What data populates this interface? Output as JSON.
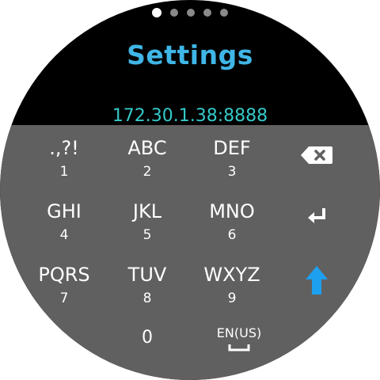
{
  "pager": {
    "count": 5,
    "active_index": 0
  },
  "app": {
    "title": "Settings"
  },
  "input": {
    "value": "172.30.1.38:8888"
  },
  "keyboard": {
    "rows": [
      [
        {
          "letters": ".,?!",
          "num": "1"
        },
        {
          "letters": "ABC",
          "num": "2"
        },
        {
          "letters": "DEF",
          "num": "3"
        }
      ],
      [
        {
          "letters": "GHI",
          "num": "4"
        },
        {
          "letters": "JKL",
          "num": "5"
        },
        {
          "letters": "MNO",
          "num": "6"
        }
      ],
      [
        {
          "letters": "PQRS",
          "num": "7"
        },
        {
          "letters": "TUV",
          "num": "8"
        },
        {
          "letters": "WXYZ",
          "num": "9"
        }
      ]
    ],
    "zero": "0",
    "language": "EN(US)",
    "icons": {
      "backspace": "backspace-icon",
      "enter": "enter-icon",
      "shift": "shift-up-arrow-icon"
    }
  },
  "colors": {
    "title": "#3fb6e6",
    "input_text": "#35c9c9",
    "keyboard_bg": "#606060",
    "shift_active": "#1ea0f0"
  }
}
